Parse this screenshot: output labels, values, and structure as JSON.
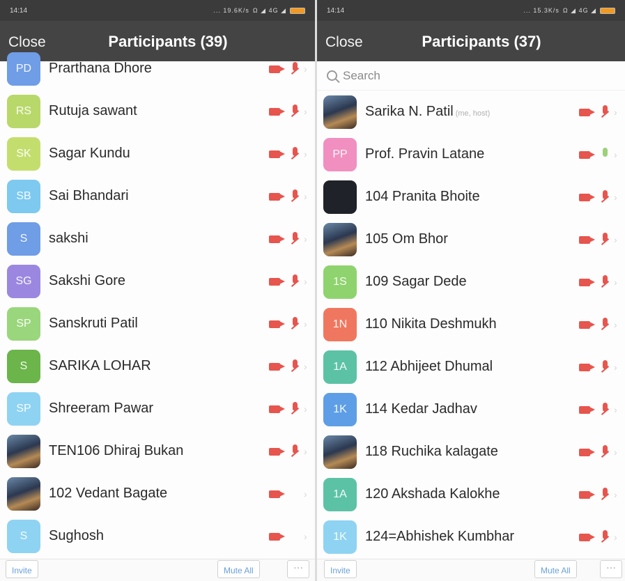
{
  "left": {
    "status": {
      "time": "14:14",
      "net": "... 19.6K/s",
      "icons": "Ω ◢ 4G ◢"
    },
    "header": {
      "close": "Close",
      "title": "Participants (39)"
    },
    "participants": [
      {
        "initials": "PD",
        "name": "Prarthana Dhore",
        "color": "#6f9de6",
        "mic": "muted"
      },
      {
        "initials": "RS",
        "name": "Rutuja sawant",
        "color": "#b9d86a",
        "mic": "muted"
      },
      {
        "initials": "SK",
        "name": "Sagar Kundu",
        "color": "#c4de6e",
        "mic": "muted"
      },
      {
        "initials": "SB",
        "name": "Sai Bhandari",
        "color": "#7ec9ef",
        "mic": "muted"
      },
      {
        "initials": "S",
        "name": "sakshi",
        "color": "#6f9de6",
        "mic": "muted"
      },
      {
        "initials": "SG",
        "name": "Sakshi Gore",
        "color": "#9b87e0",
        "mic": "muted"
      },
      {
        "initials": "SP",
        "name": "Sanskruti Patil",
        "color": "#9ad67c",
        "mic": "muted"
      },
      {
        "initials": "S",
        "name": "SARIKA LOHAR",
        "color": "#6bb54a",
        "mic": "muted"
      },
      {
        "initials": "SP",
        "name": "Shreeram Pawar",
        "color": "#8fd3f2",
        "mic": "muted"
      },
      {
        "initials": "",
        "name": "TEN106 Dhiraj Bukan",
        "color": "photo",
        "mic": "muted"
      },
      {
        "initials": "",
        "name": "102 Vedant Bagate",
        "color": "photo",
        "mic": "none"
      },
      {
        "initials": "S",
        "name": "Sughosh",
        "color": "#8fd3f2",
        "mic": "none"
      }
    ],
    "bottom": {
      "invite": "Invite",
      "mute_all": "Mute All",
      "more": "···"
    }
  },
  "right": {
    "status": {
      "time": "14:14",
      "net": "... 15.3K/s",
      "icons": "Ω ◢ 4G ◢"
    },
    "header": {
      "close": "Close",
      "title": "Participants (37)"
    },
    "search_placeholder": "Search",
    "participants": [
      {
        "initials": "",
        "name": "Sarika N. Patil",
        "tag": "(me, host)",
        "color": "photo",
        "mic": "muted"
      },
      {
        "initials": "PP",
        "name": "Prof. Pravin Latane",
        "color": "#f08fc0",
        "mic": "live"
      },
      {
        "initials": "",
        "name": "104 Pranita Bhoite",
        "color": "#1f2228",
        "mic": "muted"
      },
      {
        "initials": "",
        "name": "105 Om Bhor",
        "color": "photo",
        "mic": "muted"
      },
      {
        "initials": "1S",
        "name": "109 Sagar Dede",
        "color": "#8fd36e",
        "mic": "muted"
      },
      {
        "initials": "1N",
        "name": "110 Nikita Deshmukh",
        "color": "#f0775f",
        "mic": "muted"
      },
      {
        "initials": "1A",
        "name": "112 Abhijeet Dhumal",
        "color": "#5cc2a6",
        "mic": "muted"
      },
      {
        "initials": "1K",
        "name": "114 Kedar Jadhav",
        "color": "#5e9ee6",
        "mic": "muted"
      },
      {
        "initials": "",
        "name": "118 Ruchika kalagate",
        "color": "photo",
        "mic": "muted"
      },
      {
        "initials": "1A",
        "name": "120 Akshada Kalokhe",
        "color": "#5cc2a6",
        "mic": "muted"
      },
      {
        "initials": "1K",
        "name": "124=Abhishek Kumbhar",
        "color": "#8fd3f2",
        "mic": "muted"
      }
    ],
    "bottom": {
      "invite": "Invite",
      "mute_all": "Mute All",
      "more": "···"
    }
  }
}
